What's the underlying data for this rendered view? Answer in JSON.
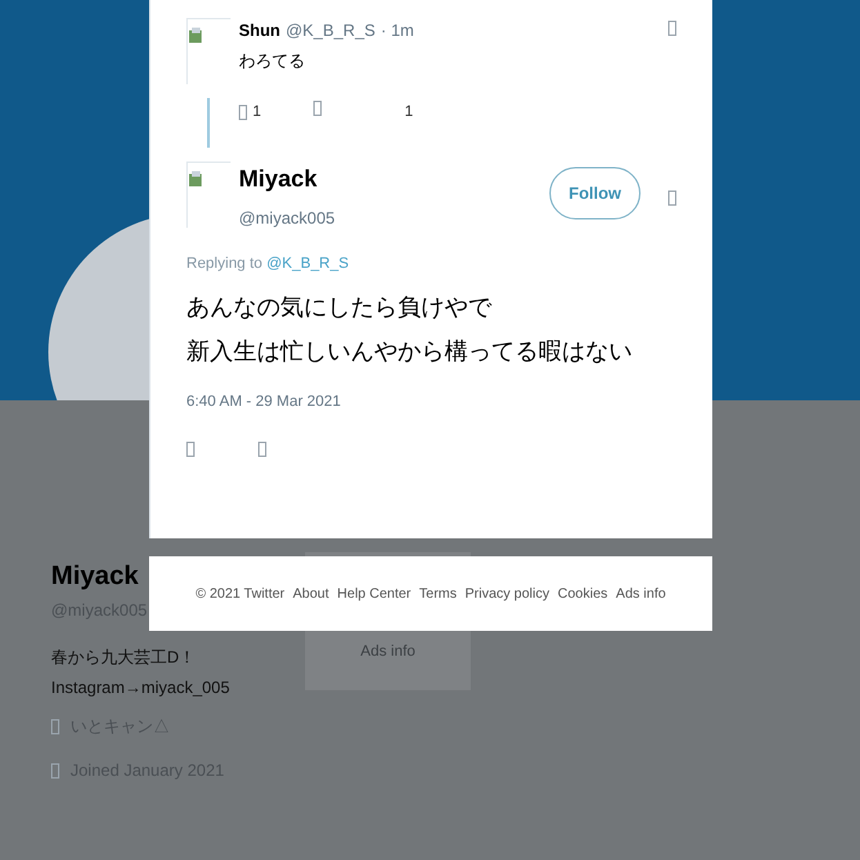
{
  "profile": {
    "name": "Miyack",
    "handle": "@miyack005",
    "bio_lines": [
      "春から九大芸工D！",
      "Instagram→miyack_005"
    ],
    "location": "いとキャン△",
    "joined": "Joined January 2021"
  },
  "sidebar_card": {
    "links": [
      "Ads info"
    ]
  },
  "modal": {
    "parent_tweet": {
      "name": "Shun",
      "handle": "@K_B_R_S",
      "time": "· 1m",
      "text": "わろてる",
      "reply_count": "1",
      "like_count": "1"
    },
    "tweet": {
      "name": "Miyack",
      "handle": "@miyack005",
      "follow_label": "Follow",
      "replying_label": "Replying to",
      "replying_to": "@K_B_R_S",
      "text_lines": [
        "あんなの気にしたら負けやで",
        "新入生は忙しいんやから構ってる暇はない"
      ],
      "timestamp": "6:40 AM - 29 Mar 2021"
    }
  },
  "footer": {
    "links": [
      "© 2021 Twitter",
      "About",
      "Help Center",
      "Terms",
      "Privacy policy",
      "Cookies",
      "Ads info"
    ]
  }
}
